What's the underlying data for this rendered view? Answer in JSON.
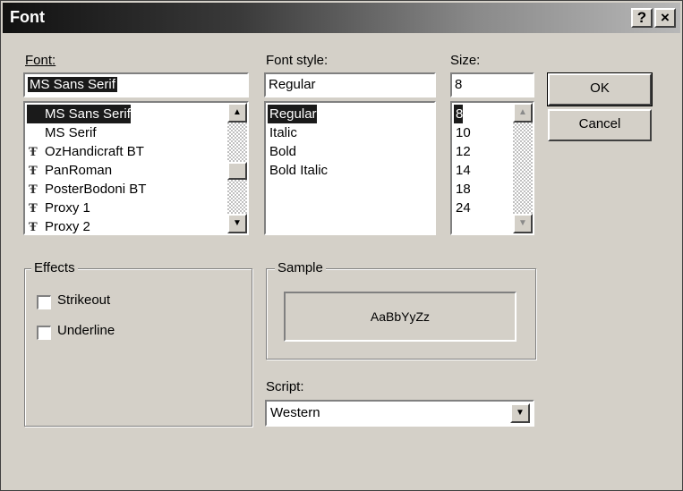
{
  "window": {
    "title": "Font",
    "help_label": "?",
    "close_label": "×"
  },
  "font": {
    "label": "Font:",
    "current_value": "MS Sans Serif",
    "items": [
      {
        "label": "MS Sans Serif",
        "icon": "none",
        "selected": true
      },
      {
        "label": "MS Serif",
        "icon": "none",
        "selected": false
      },
      {
        "label": "OzHandicraft BT",
        "icon": "truetype-icon",
        "selected": false
      },
      {
        "label": "PanRoman",
        "icon": "truetype-icon",
        "selected": false
      },
      {
        "label": "PosterBodoni BT",
        "icon": "truetype-icon",
        "selected": false
      },
      {
        "label": "Proxy 1",
        "icon": "truetype-icon",
        "selected": false
      },
      {
        "label": "Proxy 2",
        "icon": "truetype-icon",
        "selected": false
      }
    ]
  },
  "style": {
    "label": "Font style:",
    "current_value": "Regular",
    "items": [
      {
        "label": "Regular",
        "selected": true
      },
      {
        "label": "Italic",
        "selected": false
      },
      {
        "label": "Bold",
        "selected": false
      },
      {
        "label": "Bold Italic",
        "selected": false
      }
    ]
  },
  "size": {
    "label": "Size:",
    "current_value": "8",
    "items": [
      {
        "label": "8",
        "selected": true
      },
      {
        "label": "10",
        "selected": false
      },
      {
        "label": "12",
        "selected": false
      },
      {
        "label": "14",
        "selected": false
      },
      {
        "label": "18",
        "selected": false
      },
      {
        "label": "24",
        "selected": false
      }
    ]
  },
  "buttons": {
    "ok_label": "OK",
    "cancel_label": "Cancel"
  },
  "effects": {
    "label": "Effects",
    "strikeout_label": "Strikeout",
    "strikeout_checked": false,
    "underline_label": "Underline",
    "underline_checked": false
  },
  "sample": {
    "label": "Sample",
    "text": "AaBbYyZz"
  },
  "script": {
    "label": "Script:",
    "value": "Western"
  },
  "icons": {
    "truetype": "Ŧ",
    "up_arrow": "▲",
    "down_arrow": "▼"
  }
}
